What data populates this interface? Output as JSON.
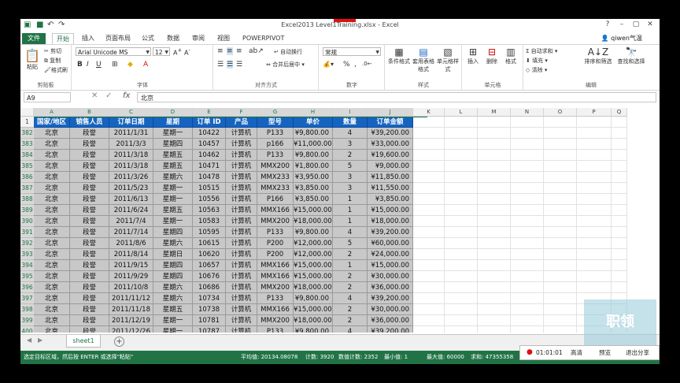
{
  "window": {
    "title": "Excel2013 Level1Training.xlsx - Excel"
  },
  "tabs": [
    "文件",
    "开始",
    "插入",
    "页面布局",
    "公式",
    "数据",
    "审阅",
    "视图",
    "POWERPIVOT"
  ],
  "user": "qiwen气温",
  "ribbon": {
    "clipboard": {
      "paste": "粘贴",
      "cut": "剪切",
      "copy": "复制",
      "format_painter": "格式刷",
      "label": "剪贴板"
    },
    "font": {
      "name": "Arial Unicode MS",
      "size": "12",
      "label": "字体"
    },
    "alignment": {
      "wrap": "自动换行",
      "merge": "合并后居中",
      "label": "对齐方式"
    },
    "number": {
      "format": "常规",
      "label": "数字"
    },
    "styles": {
      "conditional": "条件格式",
      "table": "套用表格格式",
      "cell_styles": "单元格样式",
      "label": "样式"
    },
    "cells": {
      "insert": "插入",
      "delete": "删除",
      "format": "格式",
      "label": "单元格"
    },
    "editing": {
      "autosum": "自动求和",
      "fill": "填充",
      "clear": "清除",
      "sort": "排序和筛选",
      "find": "查找和选择",
      "label": "编辑"
    }
  },
  "formula_bar": {
    "name_box": "A9",
    "fx": "fx",
    "value": "北京"
  },
  "columns": [
    "A",
    "B",
    "C",
    "D",
    "E",
    "F",
    "G",
    "H",
    "I",
    "J",
    "K",
    "L",
    "M",
    "N",
    "O",
    "P",
    "Q"
  ],
  "header_row": {
    "num": "1",
    "cells": [
      "国家/地区",
      "销售人员",
      "订单日期",
      "星期",
      "订单 ID",
      "产品",
      "型号",
      "单价",
      "数量",
      "订单金额"
    ]
  },
  "rows": [
    {
      "num": "382",
      "cells": [
        "北京",
        "段誉",
        "2011/1/31",
        "星期一",
        "10422",
        "计算机",
        "P133",
        "¥9,800.00",
        "4",
        "¥39,200.00"
      ]
    },
    {
      "num": "383",
      "cells": [
        "北京",
        "段誉",
        "2011/3/3",
        "星期四",
        "10457",
        "计算机",
        "p166",
        "¥11,000.00",
        "3",
        "¥33,000.00"
      ]
    },
    {
      "num": "384",
      "cells": [
        "北京",
        "段誉",
        "2011/3/18",
        "星期五",
        "10462",
        "计算机",
        "P133",
        "¥9,800.00",
        "2",
        "¥19,600.00"
      ]
    },
    {
      "num": "385",
      "cells": [
        "北京",
        "段誉",
        "2011/3/18",
        "星期五",
        "10471",
        "计算机",
        "MMX200",
        "¥1,800.00",
        "5",
        "¥9,000.00"
      ]
    },
    {
      "num": "386",
      "cells": [
        "北京",
        "段誉",
        "2011/3/26",
        "星期六",
        "10478",
        "计算机",
        "MMX233",
        "¥3,950.00",
        "3",
        "¥11,850.00"
      ]
    },
    {
      "num": "387",
      "cells": [
        "北京",
        "段誉",
        "2011/5/23",
        "星期一",
        "10515",
        "计算机",
        "MMX233",
        "¥3,850.00",
        "3",
        "¥11,550.00"
      ]
    },
    {
      "num": "388",
      "cells": [
        "北京",
        "段誉",
        "2011/6/13",
        "星期一",
        "10556",
        "计算机",
        "P166",
        "¥3,850.00",
        "1",
        "¥3,850.00"
      ]
    },
    {
      "num": "389",
      "cells": [
        "北京",
        "段誉",
        "2011/6/24",
        "星期五",
        "10563",
        "计算机",
        "MMX166",
        "¥15,000.00",
        "1",
        "¥15,000.00"
      ]
    },
    {
      "num": "390",
      "cells": [
        "北京",
        "段誉",
        "2011/7/4",
        "星期一",
        "10583",
        "计算机",
        "MMX200",
        "¥18,000.00",
        "1",
        "¥18,000.00"
      ]
    },
    {
      "num": "391",
      "cells": [
        "北京",
        "段誉",
        "2011/7/14",
        "星期四",
        "10595",
        "计算机",
        "P133",
        "¥9,800.00",
        "4",
        "¥39,200.00"
      ]
    },
    {
      "num": "392",
      "cells": [
        "北京",
        "段誉",
        "2011/8/6",
        "星期六",
        "10615",
        "计算机",
        "P200",
        "¥12,000.00",
        "5",
        "¥60,000.00"
      ]
    },
    {
      "num": "393",
      "cells": [
        "北京",
        "段誉",
        "2011/8/14",
        "星期日",
        "10620",
        "计算机",
        "P200",
        "¥12,000.00",
        "2",
        "¥24,000.00"
      ]
    },
    {
      "num": "394",
      "cells": [
        "北京",
        "段誉",
        "2011/9/15",
        "星期四",
        "10657",
        "计算机",
        "MMX166",
        "¥15,000.00",
        "1",
        "¥15,000.00"
      ]
    },
    {
      "num": "395",
      "cells": [
        "北京",
        "段誉",
        "2011/9/29",
        "星期四",
        "10676",
        "计算机",
        "MMX166",
        "¥15,000.00",
        "2",
        "¥30,000.00"
      ]
    },
    {
      "num": "396",
      "cells": [
        "北京",
        "段誉",
        "2011/10/8",
        "星期六",
        "10686",
        "计算机",
        "MMX200",
        "¥18,000.00",
        "2",
        "¥36,000.00"
      ]
    },
    {
      "num": "397",
      "cells": [
        "北京",
        "段誉",
        "2011/11/12",
        "星期六",
        "10734",
        "计算机",
        "P133",
        "¥9,800.00",
        "4",
        "¥39,200.00"
      ]
    },
    {
      "num": "398",
      "cells": [
        "北京",
        "段誉",
        "2011/11/18",
        "星期五",
        "10738",
        "计算机",
        "MMX166",
        "¥15,000.00",
        "2",
        "¥30,000.00"
      ]
    },
    {
      "num": "399",
      "cells": [
        "北京",
        "段誉",
        "2011/12/19",
        "星期一",
        "10781",
        "计算机",
        "MMX200",
        "¥18,000.00",
        "2",
        "¥36,000.00"
      ]
    },
    {
      "num": "400",
      "cells": [
        "北京",
        "段誉",
        "2011/12/26",
        "星期一",
        "10787",
        "计算机",
        "P133",
        "¥9,800.00",
        "4",
        "¥39,200.00"
      ]
    }
  ],
  "sheet_tab": "sheet1",
  "status": {
    "message": "选定目标区域，然后按 ENTER 或选择\"粘贴\"",
    "average": "平均值: 20134.08078",
    "count": "计数: 3920",
    "numeric_count": "数值计数: 2352",
    "min": "最小值: 1",
    "max": "最大值: 60000",
    "sum": "求和: 47355358"
  },
  "recorder": {
    "time": "01:01:01",
    "quality": "高清",
    "preview": "预览",
    "exit": "退出分享"
  },
  "watermark": "职领",
  "colors": {
    "excel_green": "#217346",
    "header_blue": "#1565c0",
    "data_gray": "#c8c8c8"
  }
}
